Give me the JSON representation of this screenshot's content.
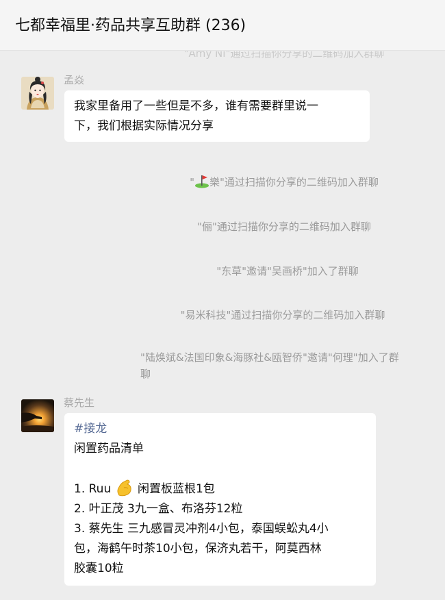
{
  "header": {
    "title": "七都幸福里·药品共享互助群 (236)"
  },
  "cut_system_line": "\"Amy Ni\"通过扫描你分享的二维码加入群聊",
  "messages": [
    {
      "sender": "孟焱",
      "avatar": "girl-portrait-avatar",
      "lines": [
        "我家里备用了一些但是不多，谁有需要群里说一",
        "下，我们根据实际情况分享"
      ]
    },
    {
      "sender": "蔡先生",
      "avatar": "sunset-hand-avatar",
      "hashtag": "#接龙",
      "title": "闲置药品清单",
      "items": [
        {
          "prefix": "1. Ruu",
          "icon": "flexed-biceps-emoji",
          "suffix": " 闲置板蓝根1包"
        },
        {
          "text": "2. 叶正茂 3九一盒、布洛芬12粒"
        },
        {
          "text": "3. 蔡先生 三九感冒灵冲剂4小包，泰国蜈蚣丸4小"
        },
        {
          "text": "包，海鹤午时茶10小包，保济丸若干，阿莫西林"
        },
        {
          "text": "胶囊10粒"
        }
      ]
    }
  ],
  "system_messages": {
    "join_qr_1": {
      "icon": "golf-flag-emoji",
      "name": "樂",
      "rest": "\"通过扫描你分享的二维码加入群聊"
    },
    "join_qr_2": "\"俪\"通过扫描你分享的二维码加入群聊",
    "invite_1": "\"东草\"邀请\"吴画桥\"加入了群聊",
    "join_qr_3": "\"易米科技\"通过扫描你分享的二维码加入群聊",
    "invite_2_line1": "\"陆焕斌&法国印象&海豚社&瓯智侨\"邀请\"何理\"加入了群",
    "invite_2_line2": "聊"
  }
}
